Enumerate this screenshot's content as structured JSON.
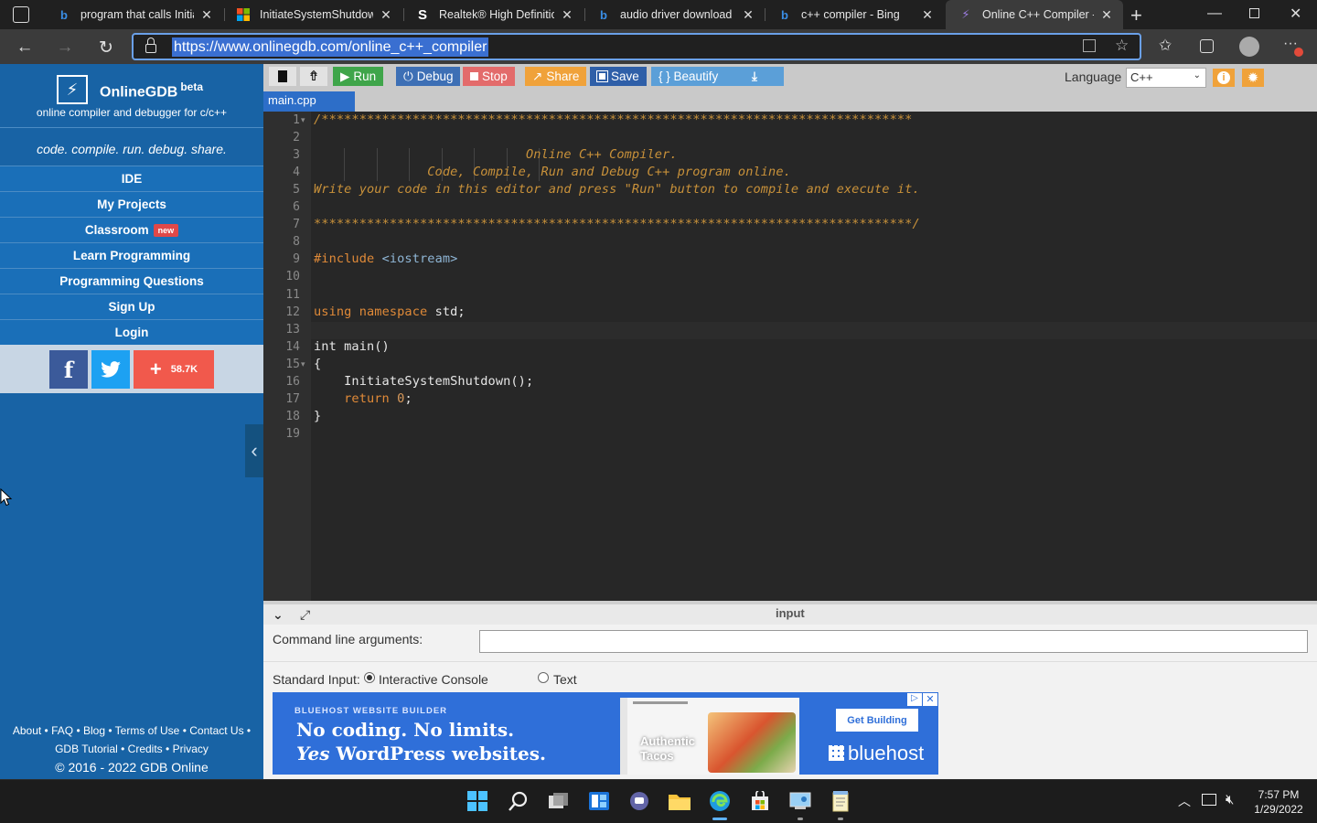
{
  "browser": {
    "tabs": [
      {
        "title": "program that calls Initiat",
        "favicon": "bing-icon",
        "active": false
      },
      {
        "title": "InitiateSystemShutdown",
        "favicon": "microsoft-icon",
        "active": false
      },
      {
        "title": "Realtek® High Definition",
        "favicon": "s-site-icon",
        "active": false
      },
      {
        "title": "audio driver download -",
        "favicon": "bing-icon",
        "active": false
      },
      {
        "title": "c++ compiler - Bing",
        "favicon": "bing-icon",
        "active": false
      },
      {
        "title": "Online C++ Compiler - o",
        "favicon": "onlinegdb-icon",
        "active": true
      }
    ],
    "url": "https://www.onlinegdb.com/online_c++_compiler"
  },
  "sidebar": {
    "brand": "OnlineGDB",
    "brand_sup": "beta",
    "tagline": "online compiler and debugger for c/c++",
    "slogan": "code. compile. run. debug. share.",
    "nav": [
      {
        "label": "IDE"
      },
      {
        "label": "My Projects"
      },
      {
        "label": "Classroom",
        "badge": "new"
      },
      {
        "label": "Learn Programming"
      },
      {
        "label": "Programming Questions"
      },
      {
        "label": "Sign Up"
      },
      {
        "label": "Login"
      }
    ],
    "share_count": "58.7K",
    "footer_line1": [
      "About",
      "FAQ",
      "Blog",
      "Terms of Use",
      "Contact Us"
    ],
    "footer_line2": [
      "GDB Tutorial",
      "Credits",
      "Privacy"
    ],
    "copyright": "© 2016 - 2022 GDB Online"
  },
  "toolbar": {
    "run": "Run",
    "debug": "Debug",
    "stop": "Stop",
    "share": "Share",
    "save": "Save",
    "beautify": "{ } Beautify",
    "language_label": "Language",
    "language_value": "C++"
  },
  "editor": {
    "file_tab": "main.cpp",
    "lines": [
      "/******************************************************************************",
      "",
      "                            Online C++ Compiler.",
      "               Code, Compile, Run and Debug C++ program online.",
      "Write your code in this editor and press \"Run\" button to compile and execute it.",
      "",
      "*******************************************************************************/",
      "",
      "#include <iostream>",
      "",
      "",
      "using namespace std;",
      "",
      "int main()",
      "{",
      "    InitiateSystemShutdown();",
      "    return 0;",
      "}",
      ""
    ]
  },
  "input_panel": {
    "title": "input",
    "cmd_label": "Command line arguments:",
    "cmd_value": "",
    "stdin_label": "Standard Input:",
    "opt_interactive": "Interactive Console",
    "opt_text": "Text"
  },
  "ad": {
    "small": "BLUEHOST WEBSITE BUILDER",
    "headline1": "No coding. No limits.",
    "headline2_em": "Yes",
    "headline2_rest": " WordPress websites.",
    "pic_text1": "Authentic",
    "pic_text2": "Tacos",
    "cta": "Get Building",
    "brand": "bluehost"
  },
  "taskbar": {
    "time": "7:57 PM",
    "date": "1/29/2022"
  }
}
